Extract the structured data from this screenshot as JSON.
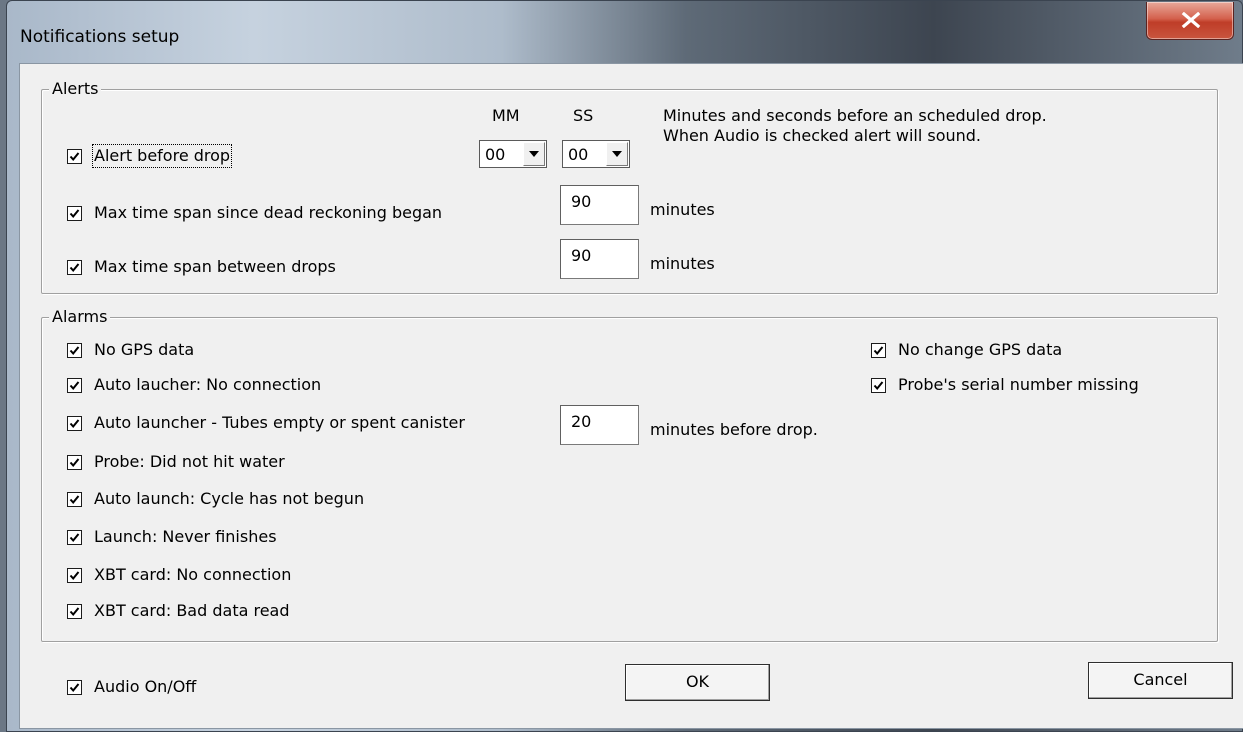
{
  "window": {
    "title": "Notifications setup",
    "close_glyph": "X"
  },
  "alerts": {
    "legend": "Alerts",
    "mm_header": "MM",
    "ss_header": "SS",
    "alert_before_drop": {
      "label": "Alert before drop",
      "checked": true
    },
    "mm_value": "00",
    "ss_value": "00",
    "note": "Minutes and seconds before an scheduled drop. When Audio is checked alert will sound.",
    "dead_reckoning": {
      "label": "Max time span since dead reckoning began",
      "checked": true,
      "value": "90",
      "unit": "minutes"
    },
    "between_drops": {
      "label": "Max time span between drops",
      "checked": true,
      "value": "90",
      "unit": "minutes"
    }
  },
  "alarms": {
    "legend": "Alarms",
    "items": [
      {
        "label": "No GPS data",
        "checked": true
      },
      {
        "label": "Auto laucher: No connection",
        "checked": true
      },
      {
        "label": "Auto launcher - Tubes empty or spent canister",
        "checked": true
      },
      {
        "label": "Probe: Did not hit water",
        "checked": true
      },
      {
        "label": "Auto launch: Cycle has not begun",
        "checked": true
      },
      {
        "label": "Launch: Never finishes",
        "checked": true
      },
      {
        "label": "XBT card: No connection",
        "checked": true
      },
      {
        "label": "XBT card: Bad data read",
        "checked": true
      }
    ],
    "right_items": [
      {
        "label": "No change GPS data",
        "checked": true
      },
      {
        "label": "Probe's serial number missing",
        "checked": true
      }
    ],
    "tubes_value": "20",
    "tubes_unit": "minutes before drop."
  },
  "footer": {
    "audio": {
      "label": "Audio On/Off",
      "checked": true
    },
    "ok_label": "OK",
    "cancel_label": "Cancel"
  },
  "icons": {
    "checkbox_mark": "check-icon",
    "dropdown": "chevron-down-icon",
    "close": "close-icon"
  },
  "colors": {
    "close_button": "#c9553e",
    "dialog_bg": "#f0f0f0"
  }
}
